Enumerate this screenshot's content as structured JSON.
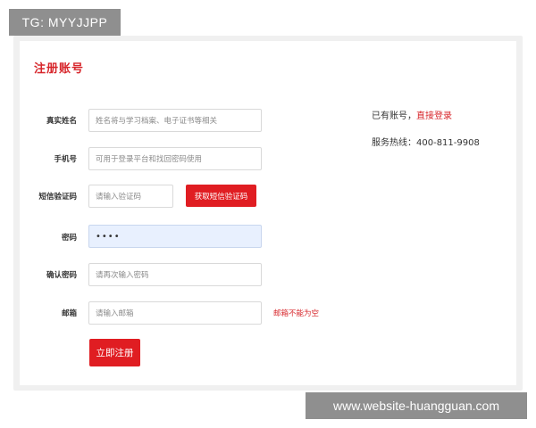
{
  "watermark_top": "TG: MYYJJPP",
  "watermark_bottom": "www.website-huangguan.com",
  "form": {
    "title": "注册账号",
    "fields": {
      "name": {
        "label": "真实姓名",
        "placeholder": "姓名将与学习档案、电子证书等相关"
      },
      "phone": {
        "label": "手机号",
        "placeholder": "可用于登录平台和找回密码使用"
      },
      "sms": {
        "label": "短信验证码",
        "placeholder": "请输入验证码",
        "button": "获取短信验证码"
      },
      "password": {
        "label": "密码",
        "value": "••••"
      },
      "confirm": {
        "label": "确认密码",
        "placeholder": "请再次输入密码"
      },
      "email": {
        "label": "邮箱",
        "placeholder": "请输入邮箱",
        "error": "邮箱不能为空"
      }
    },
    "submit_label": "立即注册"
  },
  "side": {
    "have_account": "已有账号，",
    "login_link": "直接登录",
    "hotline_label": "服务热线：",
    "hotline_number": "400-811-9908"
  },
  "colors": {
    "accent": "#e01d22",
    "title": "#d7262b",
    "active_field": "#e8f0fe"
  }
}
